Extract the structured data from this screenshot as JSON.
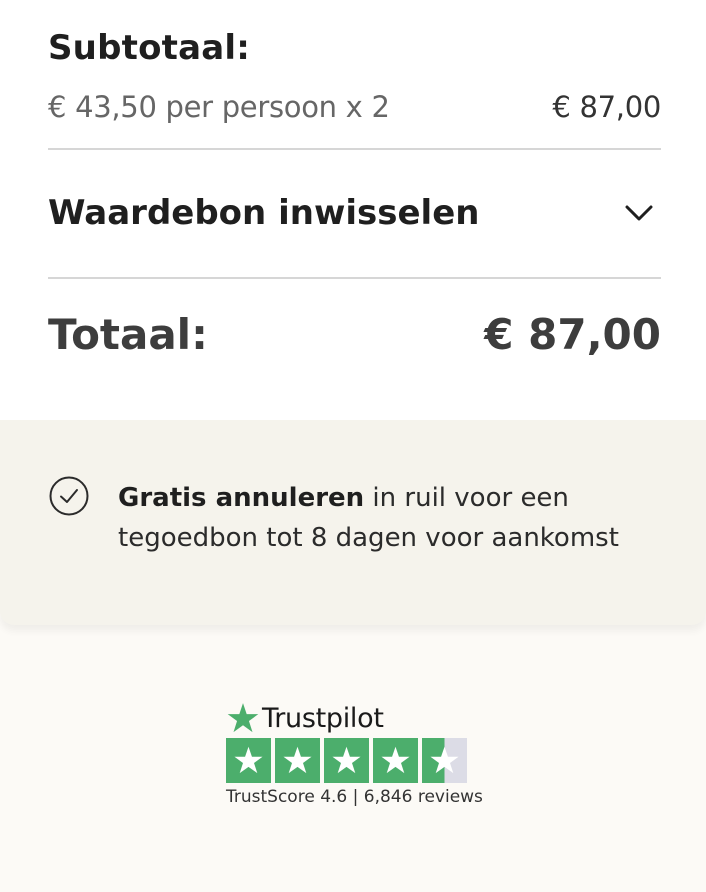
{
  "summary": {
    "subtotal_label": "Subtotaal:",
    "subtotal_line": "€ 43,50 per persoon x 2",
    "subtotal_amount": "€ 87,00",
    "voucher_label": "Waardebon inwisselen",
    "total_label": "Totaal:",
    "total_amount": "€ 87,00"
  },
  "cancellation": {
    "bold": "Gratis annuleren",
    "rest": " in ruil voor een tegoedbon tot 8 dagen voor aankomst"
  },
  "trustpilot": {
    "brand": "Trustpilot",
    "score_text": "TrustScore 4.6 | 6,846 reviews",
    "rating": 4.5,
    "star_color": "#4cae6c"
  },
  "icons": {
    "chevron": "chevron-down-icon",
    "check": "check-circle-icon",
    "star": "star-icon"
  }
}
